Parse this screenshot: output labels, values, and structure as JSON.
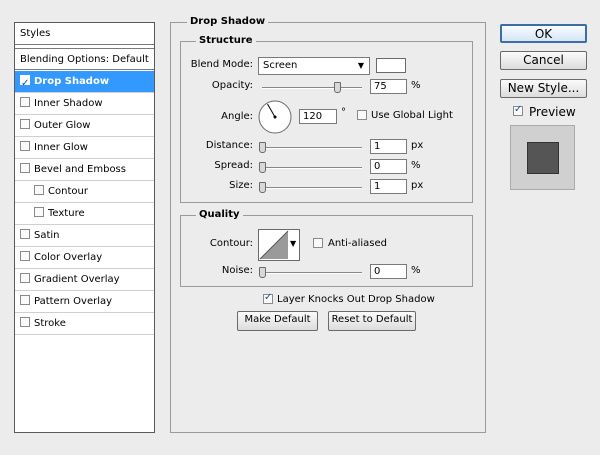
{
  "styles_panel": {
    "header": "Styles",
    "blending_options": "Blending Options: Default",
    "items": [
      {
        "label": "Drop Shadow",
        "checked": true,
        "selected": true,
        "indent": false
      },
      {
        "label": "Inner Shadow",
        "checked": false,
        "selected": false,
        "indent": false
      },
      {
        "label": "Outer Glow",
        "checked": false,
        "selected": false,
        "indent": false
      },
      {
        "label": "Inner Glow",
        "checked": false,
        "selected": false,
        "indent": false
      },
      {
        "label": "Bevel and Emboss",
        "checked": false,
        "selected": false,
        "indent": false
      },
      {
        "label": "Contour",
        "checked": false,
        "selected": false,
        "indent": true
      },
      {
        "label": "Texture",
        "checked": false,
        "selected": false,
        "indent": true
      },
      {
        "label": "Satin",
        "checked": false,
        "selected": false,
        "indent": false
      },
      {
        "label": "Color Overlay",
        "checked": false,
        "selected": false,
        "indent": false
      },
      {
        "label": "Gradient Overlay",
        "checked": false,
        "selected": false,
        "indent": false
      },
      {
        "label": "Pattern Overlay",
        "checked": false,
        "selected": false,
        "indent": false
      },
      {
        "label": "Stroke",
        "checked": false,
        "selected": false,
        "indent": false
      }
    ]
  },
  "drop_shadow": {
    "title": "Drop Shadow",
    "structure": {
      "title": "Structure",
      "blend_mode_label": "Blend Mode:",
      "blend_mode_value": "Screen",
      "blend_color": "#ffffff",
      "opacity_label": "Opacity:",
      "opacity_value": "75",
      "opacity_level": 75,
      "opacity_unit": "%",
      "angle_label": "Angle:",
      "angle_value": "120",
      "angle_unit": "°",
      "global_light_label": "Use Global Light",
      "global_light_checked": false,
      "distance_label": "Distance:",
      "distance_value": "1",
      "distance_unit": "px",
      "spread_label": "Spread:",
      "spread_value": "0",
      "spread_unit": "%",
      "size_label": "Size:",
      "size_value": "1",
      "size_unit": "px"
    },
    "quality": {
      "title": "Quality",
      "contour_label": "Contour:",
      "anti_aliased_label": "Anti-aliased",
      "anti_aliased_checked": false,
      "noise_label": "Noise:",
      "noise_value": "0",
      "noise_unit": "%"
    },
    "knocks_out_label": "Layer Knocks Out Drop Shadow",
    "knocks_out_checked": true,
    "make_default_label": "Make Default",
    "reset_default_label": "Reset to Default"
  },
  "buttons": {
    "ok": "OK",
    "cancel": "Cancel",
    "new_style": "New Style...",
    "preview_label": "Preview",
    "preview_checked": true
  },
  "colors": {
    "selection": "#3399ff",
    "preview_fill": "#555555"
  }
}
